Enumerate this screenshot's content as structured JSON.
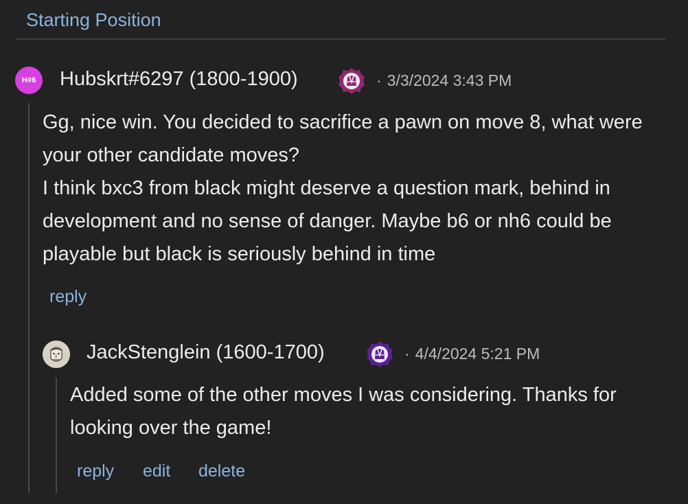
{
  "header": {
    "title": "Starting Position"
  },
  "comments": [
    {
      "avatar_initials": "H#6",
      "username": "Hubskrt#6297 (1800-1900)",
      "badge_icon": "robe-badge-icon",
      "badge_color": "#8e2a72",
      "timestamp": "3/3/2024 3:43 PM",
      "body": [
        "Gg, nice win. You decided to sacrifice a pawn on move 8, what were your other candidate moves?",
        "I think bxc3 from black might deserve a question mark, behind in development and no sense of danger. Maybe b6 or nh6 could be playable but black is seriously behind in time"
      ],
      "actions": {
        "reply": "reply"
      }
    },
    {
      "avatar_icon": "sketch-face-avatar-icon",
      "username": "JackStenglein (1600-1700)",
      "badge_icon": "robe-badge-icon",
      "badge_color": "#5b2191",
      "timestamp": "4/4/2024 5:21 PM",
      "body": [
        "Added some of the other moves I was considering. Thanks for looking over the game!"
      ],
      "actions": {
        "reply": "reply",
        "edit": "edit",
        "delete": "delete"
      }
    }
  ],
  "colors": {
    "background": "#222222",
    "link": "#8ab4e0",
    "text": "#ececec",
    "muted": "#bdbdbd",
    "avatar_initials_bg": "#d63fe0"
  }
}
